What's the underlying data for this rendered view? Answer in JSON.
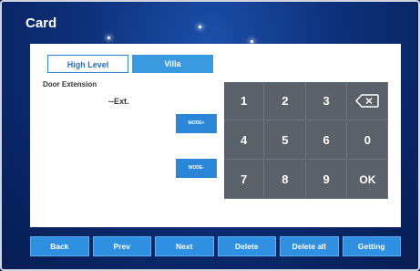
{
  "header": {
    "title": "Card"
  },
  "tabs": [
    {
      "label": "High Level",
      "active": false
    },
    {
      "label": "Villa",
      "active": true
    }
  ],
  "form": {
    "door_extension_label": "Door Extension",
    "ext_value": "--Ext."
  },
  "mode_buttons": [
    "MODE+",
    "MODE-"
  ],
  "keypad": {
    "keys": [
      "1",
      "2",
      "3",
      "backspace",
      "4",
      "5",
      "6",
      "0",
      "7",
      "8",
      "9",
      "OK"
    ]
  },
  "footer": {
    "buttons": [
      "Back",
      "Prev",
      "Next",
      "Delete",
      "Delete all",
      "Getting"
    ]
  },
  "colors": {
    "accent": "#2f8fe0",
    "keypad_bg": "#5b6168",
    "background": "#0d2f78"
  }
}
